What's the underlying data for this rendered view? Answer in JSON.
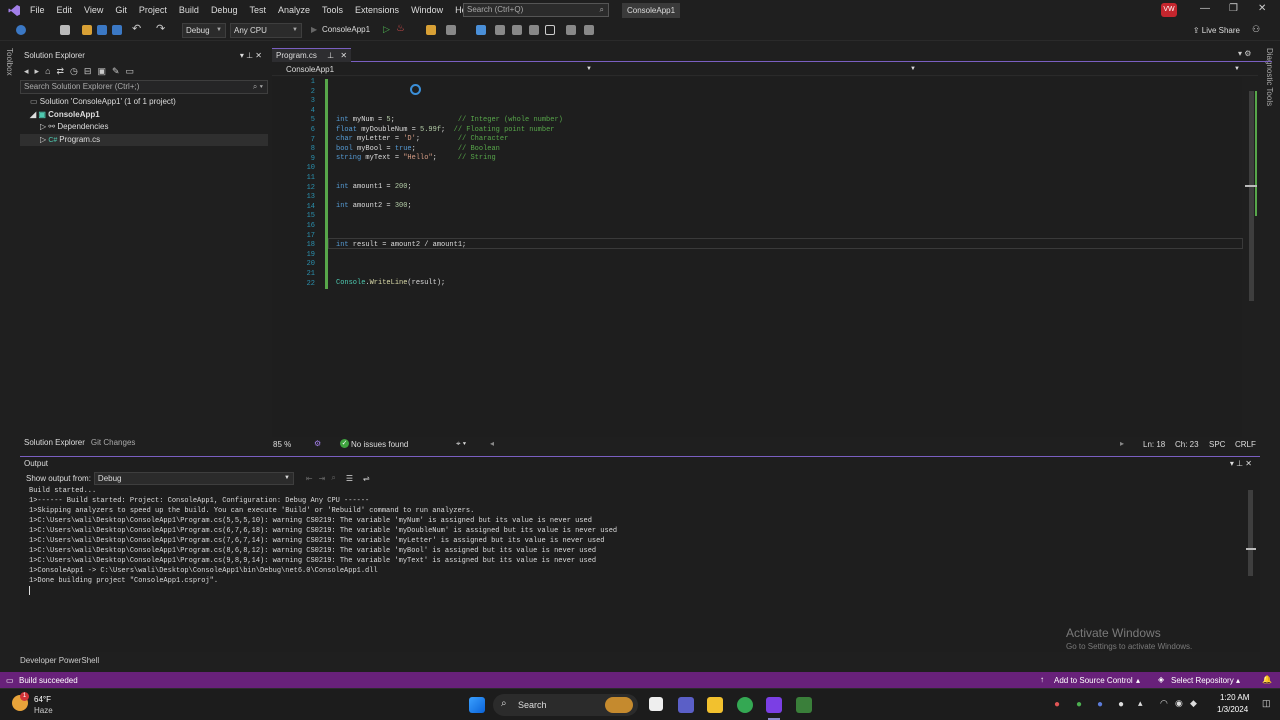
{
  "menu": {
    "items": [
      "File",
      "Edit",
      "View",
      "Git",
      "Project",
      "Build",
      "Debug",
      "Test",
      "Analyze",
      "Tools",
      "Extensions",
      "Window",
      "Help"
    ],
    "search_placeholder": "Search (Ctrl+Q)",
    "solution_name": "ConsoleApp1",
    "avatar_initials": "VW"
  },
  "toolbar": {
    "config": "Debug",
    "platform": "Any CPU",
    "run_target": "ConsoleApp1",
    "live_share": "Live Share"
  },
  "left_strip": {
    "toolbox": "Toolbox"
  },
  "right_strip": {
    "diag": "Diagnostic Tools"
  },
  "solution_explorer": {
    "title": "Solution Explorer",
    "search_placeholder": "Search Solution Explorer (Ctrl+;)",
    "tree": [
      {
        "label": "Solution 'ConsoleApp1' (1 of 1 project)",
        "icon": "solution-icon"
      },
      {
        "label": "ConsoleApp1",
        "icon": "csharp-project-icon"
      },
      {
        "label": "Dependencies",
        "icon": "dependencies-icon"
      },
      {
        "label": "Program.cs",
        "icon": "csharp-file-icon"
      }
    ],
    "tab_solution": "Solution Explorer",
    "tab_git": "Git Changes"
  },
  "editor": {
    "tab": "Program.cs",
    "nav_left": "ConsoleApp1",
    "zoom": "85 %",
    "issues": "No issues found",
    "ln": "Ln: 18",
    "ch": "Ch: 23",
    "spc": "SPC",
    "crlf": "CRLF",
    "line_numbers": [
      "1",
      "2",
      "3",
      "4",
      "5",
      "6",
      "7",
      "8",
      "9",
      "10",
      "11",
      "12",
      "13",
      "14",
      "15",
      "16",
      "17",
      "18",
      "19",
      "20",
      "21",
      "22"
    ]
  },
  "output": {
    "title": "Output",
    "show_from_label": "Show output from:",
    "source": "Debug",
    "lines": [
      "Build started...",
      "1>------ Build started: Project: ConsoleApp1, Configuration: Debug Any CPU ------",
      "1>Skipping analyzers to speed up the build. You can execute 'Build' or 'Rebuild' command to run analyzers.",
      "1>C:\\Users\\wali\\Desktop\\ConsoleApp1\\Program.cs(5,5,5,10): warning CS0219: The variable 'myNum' is assigned but its value is never used",
      "1>C:\\Users\\wali\\Desktop\\ConsoleApp1\\Program.cs(6,7,6,18): warning CS0219: The variable 'myDoubleNum' is assigned but its value is never used",
      "1>C:\\Users\\wali\\Desktop\\ConsoleApp1\\Program.cs(7,6,7,14): warning CS0219: The variable 'myLetter' is assigned but its value is never used",
      "1>C:\\Users\\wali\\Desktop\\ConsoleApp1\\Program.cs(8,6,8,12): warning CS0219: The variable 'myBool' is assigned but its value is never used",
      "1>C:\\Users\\wali\\Desktop\\ConsoleApp1\\Program.cs(9,8,9,14): warning CS0219: The variable 'myText' is assigned but its value is never used",
      "1>ConsoleApp1 -> C:\\Users\\wali\\Desktop\\ConsoleApp1\\bin\\Debug\\net6.0\\ConsoleApp1.dll",
      "1>Done building project \"ConsoleApp1.csproj\"."
    ]
  },
  "watermark": {
    "line1": "Activate Windows",
    "line2": "Go to Settings to activate Windows."
  },
  "dev_ps": "Developer PowerShell",
  "status_bar": {
    "build": "Build succeeded",
    "source_control": "Add to Source Control",
    "repo": "Select Repository"
  },
  "taskbar": {
    "weather_temp": "64°F",
    "weather_desc": "Haze",
    "search": "Search",
    "time": "1:20 AM",
    "date": "1/3/2024"
  },
  "colors": {
    "accent": "#68217a",
    "keyword": "#569cd6",
    "comment": "#57a64a"
  }
}
